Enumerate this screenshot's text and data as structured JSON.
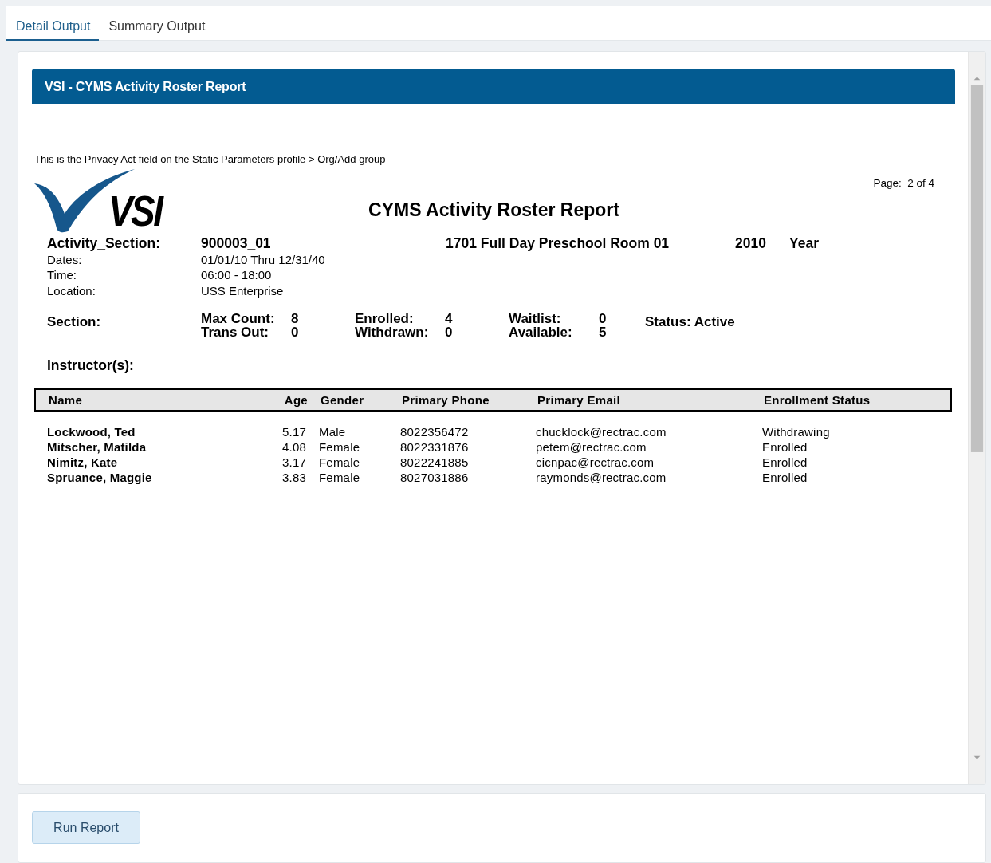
{
  "tabs": [
    {
      "label": "Detail Output",
      "selected": true
    },
    {
      "label": "Summary Output",
      "selected": false
    }
  ],
  "report": {
    "banner": "VSI - CYMS Activity Roster Report",
    "privacy_note": "This is the Privacy Act field on the Static Parameters profile > Org/Add group",
    "logo_text": "VSI",
    "title": "CYMS Activity Roster Report",
    "page": "Page:  2 of 4",
    "activity": {
      "label": "Activity_Section:",
      "code": "900003_01",
      "name": "1701 Full Day Preschool Room 01",
      "year": "2010",
      "year_label": "Year"
    },
    "details": [
      {
        "label": "Dates:",
        "value": "01/01/10 Thru 12/31/40"
      },
      {
        "label": "Time:",
        "value": "06:00 - 18:00"
      },
      {
        "label": "Location:",
        "value": "USS Enterprise"
      }
    ],
    "section": {
      "label": "Section:",
      "groups": [
        {
          "items": [
            {
              "label": "Max Count:",
              "value": "8"
            },
            {
              "label": "Trans Out:",
              "value": "0"
            }
          ]
        },
        {
          "items": [
            {
              "label": "Enrolled:",
              "value": "4"
            },
            {
              "label": "Withdrawn:",
              "value": "0"
            }
          ]
        },
        {
          "items": [
            {
              "label": "Waitlist:",
              "value": "0"
            },
            {
              "label": "Available:",
              "value": "5"
            }
          ]
        }
      ],
      "status": "Status: Active"
    },
    "instructors_label": "Instructor(s):",
    "table": {
      "columns": [
        "Name",
        "Age",
        "Gender",
        "Primary Phone",
        "Primary Email",
        "Enrollment Status"
      ],
      "rows": [
        [
          "Lockwood, Ted",
          "5.17",
          "Male",
          "8022356472",
          "chucklock@rectrac.com",
          "Withdrawing"
        ],
        [
          "Mitscher, Matilda",
          "4.08",
          "Female",
          "8022331876",
          "petem@rectrac.com",
          "Enrolled"
        ],
        [
          "Nimitz, Kate",
          "3.17",
          "Female",
          "8022241885",
          "cicnpac@rectrac.com",
          "Enrolled"
        ],
        [
          "Spruance, Maggie",
          "3.83",
          "Female",
          "8027031886",
          "raymonds@rectrac.com",
          "Enrolled"
        ]
      ]
    }
  },
  "buttons": [
    {
      "label": "Run Report"
    }
  ]
}
